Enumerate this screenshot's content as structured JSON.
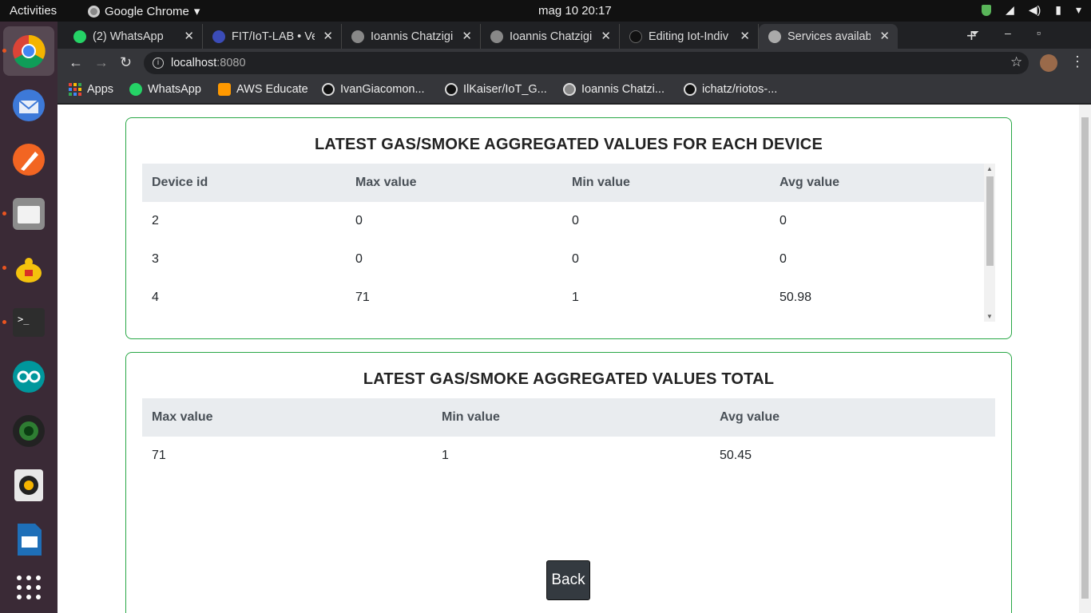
{
  "topbar": {
    "activities": "Activities",
    "app_name": "Google Chrome",
    "clock": "mag 10  20:17"
  },
  "browser": {
    "tabs": [
      {
        "label": "(2) WhatsApp"
      },
      {
        "label": "FIT/IoT-LAB • Ve"
      },
      {
        "label": "Ioannis Chatzigi"
      },
      {
        "label": "Ioannis Chatzigi"
      },
      {
        "label": "Editing Iot-Indiv"
      },
      {
        "label": "Services availab"
      }
    ],
    "address": {
      "host": "localhost",
      "port": ":8080"
    },
    "bookmarks": [
      {
        "label": "Apps"
      },
      {
        "label": "WhatsApp"
      },
      {
        "label": "AWS Educate"
      },
      {
        "label": "IvanGiacomon..."
      },
      {
        "label": "IlKaiser/IoT_G..."
      },
      {
        "label": "Ioannis Chatzi..."
      },
      {
        "label": "ichatz/riotos-..."
      }
    ]
  },
  "device_table": {
    "title": "LATEST GAS/SMOKE AGGREGATED VALUES FOR EACH DEVICE",
    "headers": [
      "Device id",
      "Max value",
      "Min value",
      "Avg value"
    ],
    "rows": [
      [
        "2",
        "0",
        "0",
        "0"
      ],
      [
        "3",
        "0",
        "0",
        "0"
      ],
      [
        "4",
        "71",
        "1",
        "50.98"
      ]
    ]
  },
  "total_table": {
    "title": "LATEST GAS/SMOKE AGGREGATED VALUES TOTAL",
    "headers": [
      "Max value",
      "Min value",
      "Avg value"
    ],
    "rows": [
      [
        "71",
        "1",
        "50.45"
      ]
    ]
  },
  "back_label": "Back"
}
